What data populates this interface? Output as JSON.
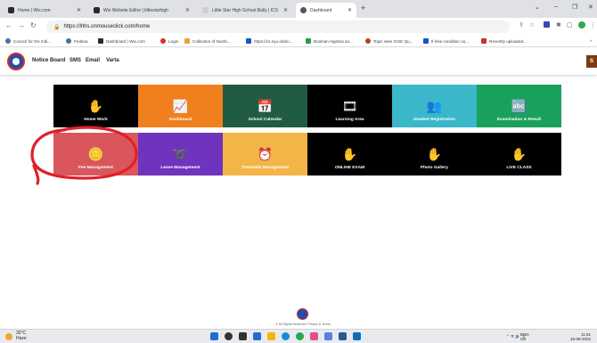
{
  "browser": {
    "tabs": [
      {
        "label": "Home | Wix.com",
        "favicon_color": "#2a2a2a",
        "active": false
      },
      {
        "label": "Wix Website Editor | littlestarhigh",
        "favicon_color": "#2a2a2a",
        "active": false
      },
      {
        "label": "Little Star High School Bally | ICS",
        "favicon_color": "#cfcfcf",
        "active": false
      },
      {
        "label": "Dashboard",
        "favicon_color": "#555555",
        "active": true
      }
    ],
    "new_tab_symbol": "+",
    "window_controls": [
      "⌄",
      "–",
      "❐",
      "✕"
    ],
    "url": "https://lhhs.onmouseclick.com/home",
    "bookmarks": [
      {
        "label": "Council for the Indi...",
        "color": "#4a6fa5"
      },
      {
        "label": "Fedena",
        "color": "#4a6fa5"
      },
      {
        "label": "Dashboard | Wix.com",
        "color": "#2a2a2a"
      },
      {
        "label": "Login",
        "color": "#d93025"
      },
      {
        "label": "Collection of Numb...",
        "color": "#e8a33d"
      },
      {
        "label": "https://cs.nyu.edu/c...",
        "color": "#1a56c4"
      },
      {
        "label": "Boolean Algebra an...",
        "color": "#2d9c4a"
      },
      {
        "label": "Topic wise ICSE Qu...",
        "color": "#c0392b"
      },
      {
        "label": "If else condition ou...",
        "color": "#1a56c4"
      },
      {
        "label": "Recently uploaded...",
        "color": "#c0392b"
      }
    ],
    "more_bookmarks": "»"
  },
  "header": {
    "menu": [
      "Notice Board",
      "SMS",
      "Email",
      "Varta"
    ],
    "profile_initial": "S"
  },
  "tiles": [
    {
      "label": "Home Work",
      "bg": "#000000",
      "icon": "✋",
      "icon_name": "handshake-icon"
    },
    {
      "label": "Dashboard",
      "bg": "#f07f1d",
      "icon": "📈",
      "icon_name": "chart-icon"
    },
    {
      "label": "School Calendar",
      "bg": "#1f5c43",
      "icon": "📅",
      "icon_name": "calendar-icon"
    },
    {
      "label": "Learning Area",
      "bg": "#000000",
      "icon": "🎞",
      "icon_name": "film-icon"
    },
    {
      "label": "Student Registration",
      "bg": "#3ab7c9",
      "icon": "👥",
      "icon_name": "users-icon"
    },
    {
      "label": "Examination & Result",
      "bg": "#19a05c",
      "icon": "🔤",
      "icon_name": "abc-blocks-icon"
    },
    {
      "label": "Fee Management",
      "bg": "#d9575c",
      "icon": "🪙",
      "icon_name": "coins-icon"
    },
    {
      "label": "Leave Management",
      "bg": "#7033bd",
      "icon": "➰",
      "icon_name": "loop-arrow-icon"
    },
    {
      "label": "Timetable Management",
      "bg": "#f4b548",
      "icon": "⏰",
      "icon_name": "alarm-clock-icon"
    },
    {
      "label": "ONLINE EXAM",
      "bg": "#000000",
      "icon": "✋",
      "icon_name": "handshake-icon"
    },
    {
      "label": "Photo Gallery",
      "bg": "#000000",
      "icon": "✋",
      "icon_name": "handshake-icon"
    },
    {
      "label": "LIVE CLASS",
      "bg": "#000000",
      "icon": "✋",
      "icon_name": "handshake-icon"
    }
  ],
  "annotation_color": "#e0202a",
  "footer": {
    "text": "© All Rights Reserved. Privacy & Terms"
  },
  "taskbar": {
    "weather_temp": "32°C",
    "weather_desc": "Haze",
    "apps": [
      {
        "name": "windows-icon",
        "color": "#1f6fd1"
      },
      {
        "name": "search-icon",
        "color": "#333333"
      },
      {
        "name": "task-view-icon",
        "color": "#333333"
      },
      {
        "name": "widgets-icon",
        "color": "#1f6fd1"
      },
      {
        "name": "file-explorer-icon",
        "color": "#f2b705"
      },
      {
        "name": "edge-icon",
        "color": "#1a8ad4"
      },
      {
        "name": "chrome-icon",
        "color": "#2aa44f"
      },
      {
        "name": "paint-icon",
        "color": "#e04e8a"
      },
      {
        "name": "store-icon",
        "color": "#5a7fd8"
      },
      {
        "name": "word-icon",
        "color": "#2b579a"
      },
      {
        "name": "outlook-icon",
        "color": "#0f6cbd"
      }
    ],
    "tray_lang": "ENG",
    "tray_region": "US",
    "tray_icons": "⌃  ᯤ 🔊 🔋",
    "time": "11:51",
    "date": "16-08-2022"
  }
}
